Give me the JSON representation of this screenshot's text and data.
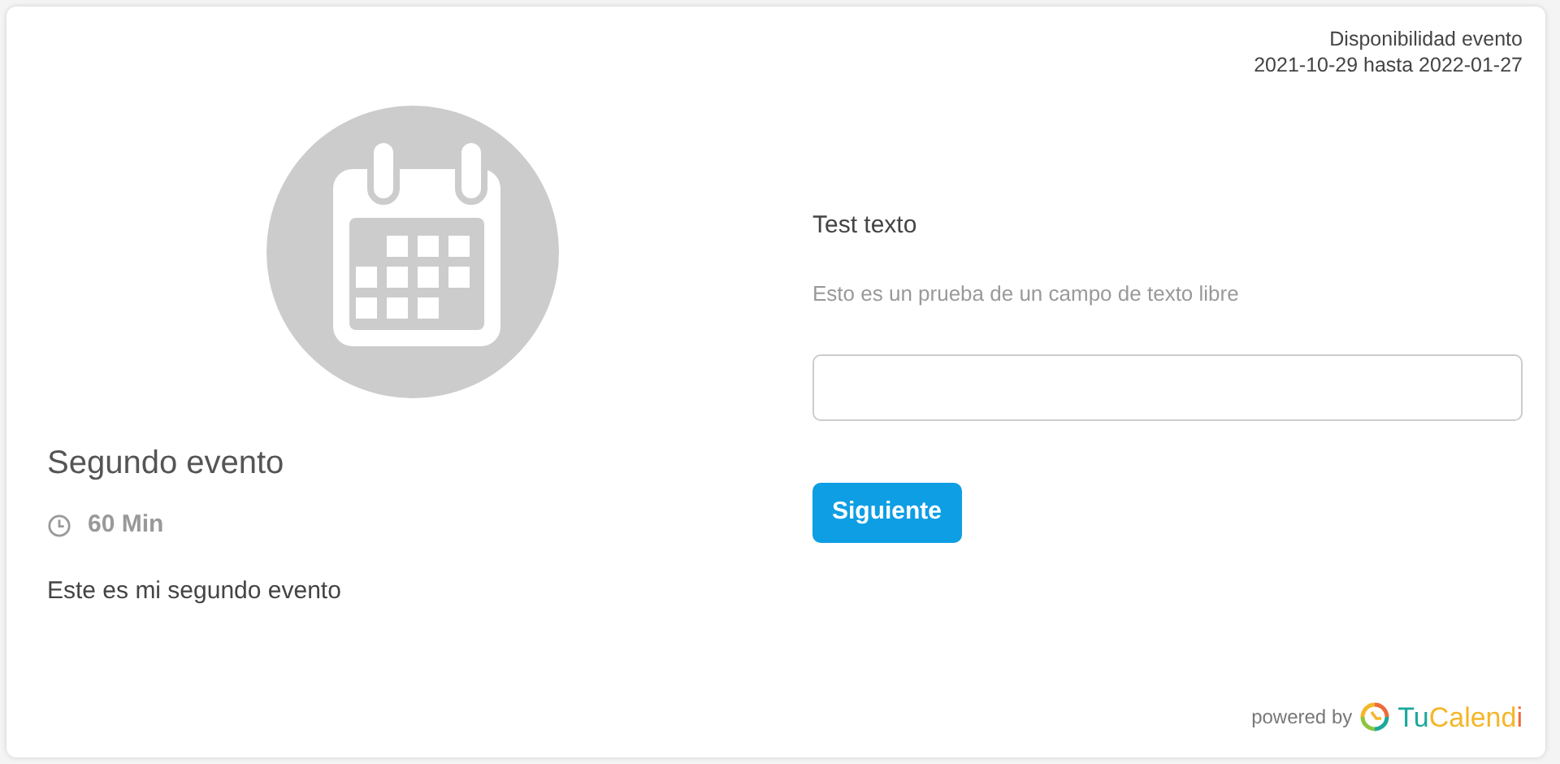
{
  "availability": {
    "label": "Disponibilidad evento",
    "range": "2021-10-29 hasta 2022-01-27"
  },
  "event": {
    "title": "Segundo evento",
    "duration": "60 Min",
    "description": "Este es mi segundo evento"
  },
  "form": {
    "label": "Test texto",
    "help": "Esto es un prueba de un campo de texto libre"
  },
  "buttons": [
    {
      "label": "Siguiente"
    }
  ],
  "footer": {
    "powered_by": "powered by",
    "logo_parts": [
      {
        "text": "Tu",
        "color": "#1ba89c"
      },
      {
        "text": "Calend",
        "color": "#f5b629"
      },
      {
        "text": "i",
        "color": "#ef6a3a"
      }
    ]
  }
}
